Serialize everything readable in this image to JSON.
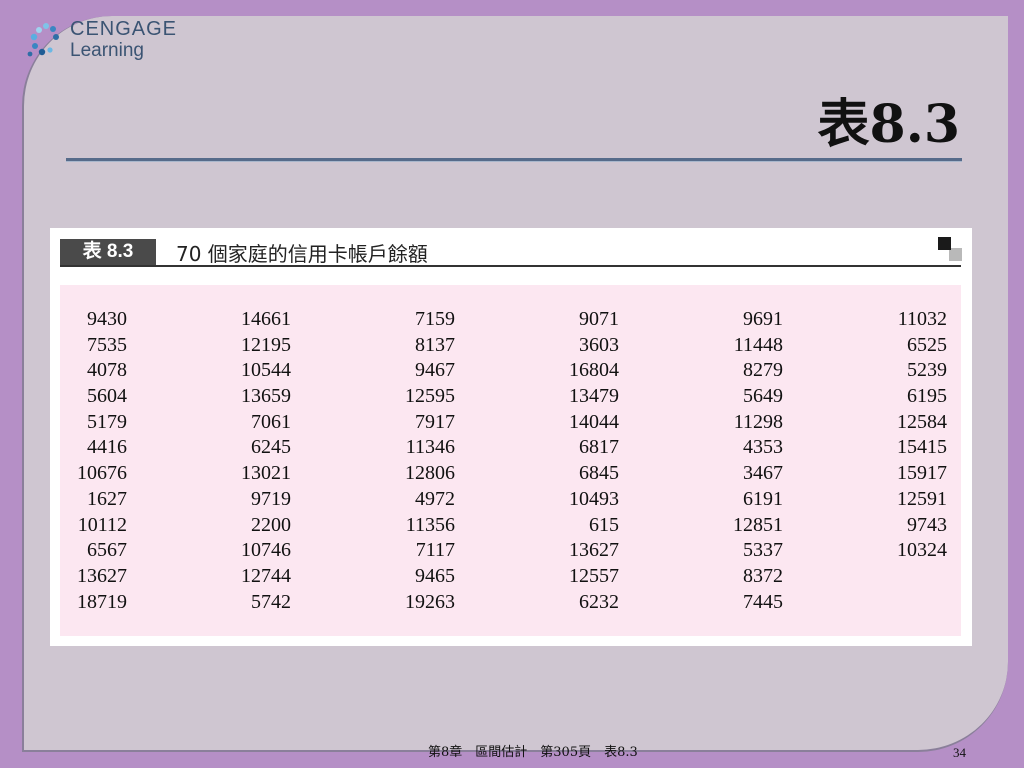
{
  "logo": {
    "line1": "CENGAGE",
    "line2": "Learning",
    "mark_icon": "cengage-swirl-icon"
  },
  "title": {
    "text": "表8.3"
  },
  "table": {
    "label": "表 8.3",
    "caption": "70 個家庭的信用卡帳戶餘額",
    "columns": [
      [
        "9430",
        "7535",
        "4078",
        "5604",
        "5179",
        "4416",
        "10676",
        "1627",
        "10112",
        "6567",
        "13627",
        "18719"
      ],
      [
        "14661",
        "12195",
        "10544",
        "13659",
        "7061",
        "6245",
        "13021",
        "9719",
        "2200",
        "10746",
        "12744",
        "5742"
      ],
      [
        "7159",
        "8137",
        "9467",
        "12595",
        "7917",
        "11346",
        "12806",
        "4972",
        "11356",
        "7117",
        "9465",
        "19263"
      ],
      [
        "9071",
        "3603",
        "16804",
        "13479",
        "14044",
        "6817",
        "6845",
        "10493",
        "615",
        "13627",
        "12557",
        "6232"
      ],
      [
        "9691",
        "11448",
        "8279",
        "5649",
        "11298",
        "4353",
        "3467",
        "6191",
        "12851",
        "5337",
        "8372",
        "7445"
      ],
      [
        "11032",
        "6525",
        "5239",
        "6195",
        "12584",
        "15415",
        "15917",
        "12591",
        "9743",
        "10324"
      ]
    ]
  },
  "footer": {
    "text": "第8章　區間估計　第305頁　表8.3",
    "page": "34"
  },
  "colors": {
    "background": "#b58fc6",
    "panel": "#cfc6d1",
    "table_fill": "#fce7f1",
    "rule": "#566b8a"
  }
}
